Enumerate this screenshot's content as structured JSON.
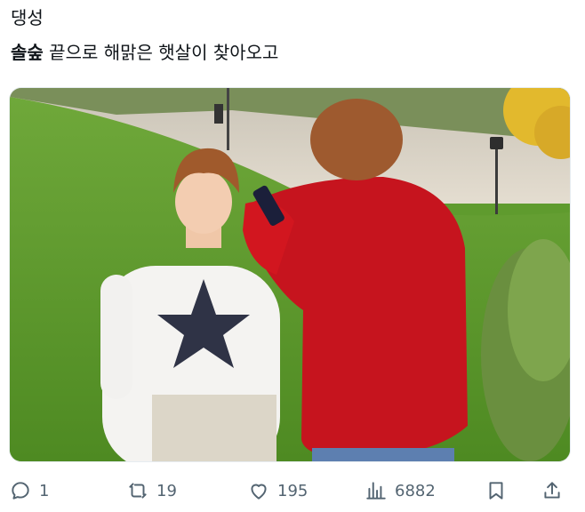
{
  "tweet": {
    "author": "댕성",
    "text_bold": "솔숲",
    "text_rest": " 끝으로 해맑은 햇살이 찾아오고"
  },
  "photo": {
    "description_icon": "photo"
  },
  "actions": {
    "reply_count": "1",
    "retweet_count": "19",
    "like_count": "195",
    "view_count": "6882"
  },
  "colors": {
    "icon": "#536471",
    "text": "#0f1419"
  }
}
